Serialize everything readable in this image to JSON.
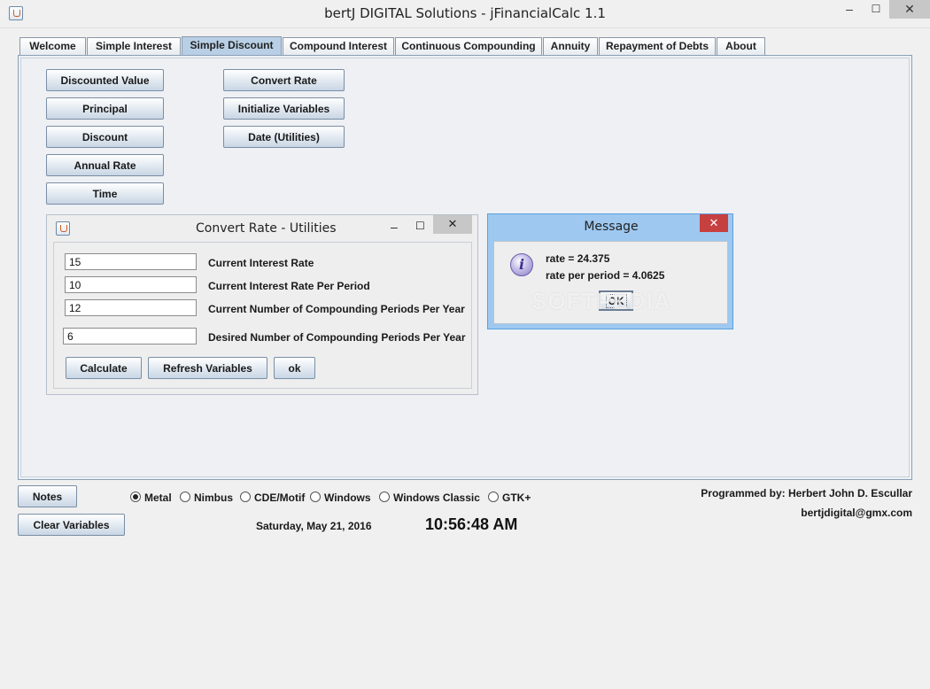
{
  "window": {
    "title": "bertJ DIGITAL Solutions - jFinancialCalc 1.1",
    "minimize": "–",
    "maximize": "☐",
    "close": "✕"
  },
  "tabs": [
    {
      "label": "Welcome"
    },
    {
      "label": "Simple Interest"
    },
    {
      "label": "Simple Discount"
    },
    {
      "label": "Compound Interest"
    },
    {
      "label": "Continuous Compounding"
    },
    {
      "label": "Annuity"
    },
    {
      "label": "Repayment of Debts"
    },
    {
      "label": "About"
    }
  ],
  "left_buttons": [
    "Discounted Value",
    "Principal",
    "Discount",
    "Annual Rate",
    "Time"
  ],
  "right_buttons": [
    "Convert Rate",
    "Initialize Variables",
    "Date (Utilities)"
  ],
  "convert_frame": {
    "title": "Convert Rate - Utilities",
    "minimize": "–",
    "maximize": "☐",
    "close": "✕",
    "fields": [
      {
        "value": "15",
        "label": "Current Interest Rate"
      },
      {
        "value": "10",
        "label": "Current Interest Rate Per Period"
      },
      {
        "value": "12",
        "label": "Current Number of Compounding Periods Per Year"
      },
      {
        "value": "6",
        "label": "Desired Number of Compounding Periods Per Year"
      }
    ],
    "buttons": {
      "calculate": "Calculate",
      "refresh": "Refresh Variables",
      "ok": "ok"
    }
  },
  "message": {
    "title": "Message",
    "close": "✕",
    "icon": "i",
    "line1": "rate = 24.375",
    "line2": "rate per period = 4.0625",
    "ok": "OK",
    "watermark": "SOFTPEDIA"
  },
  "bottom": {
    "notes": "Notes",
    "clear": "Clear Variables",
    "looks": [
      {
        "label": "Metal",
        "selected": true
      },
      {
        "label": "Nimbus",
        "selected": false
      },
      {
        "label": "CDE/Motif",
        "selected": false
      },
      {
        "label": "Windows",
        "selected": false
      },
      {
        "label": "Windows Classic",
        "selected": false
      },
      {
        "label": "GTK+",
        "selected": false
      }
    ],
    "date": "Saturday, May 21, 2016",
    "time": "10:56:48 AM",
    "programmer": "Programmed by: Herbert John D. Escullar",
    "email": "bertjdigital@gmx.com"
  }
}
